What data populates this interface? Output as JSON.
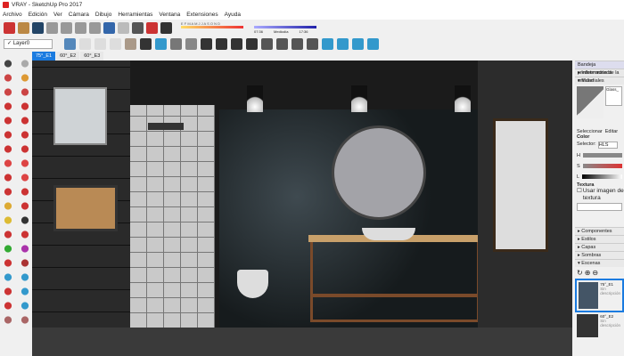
{
  "window": {
    "title": "VRAY - SketchUp Pro 2017"
  },
  "menu": [
    "Archivo",
    "Edición",
    "Ver",
    "Cámara",
    "Dibujo",
    "Herramientas",
    "Ventana",
    "Extensiones",
    "Ayuda"
  ],
  "toolbar": {
    "layer": "Layer0",
    "months": "E F M A M J J A S O N D",
    "time1": "07:36",
    "time_label": "Mediodía",
    "time2": "17:36"
  },
  "scene_tabs": [
    "75°_E1",
    "60°_E2",
    "60°_E3"
  ],
  "right_panel": {
    "title": "Bandeja predeterminada",
    "info": "Información de la entidad",
    "materials": "Materiales",
    "material_name": "Glass_",
    "tab_select": "Seleccionar",
    "tab_edit": "Editar",
    "color": "Color",
    "selector_label": "Selector:",
    "selector_value": "HLS",
    "h": "H",
    "s": "S",
    "l": "L",
    "texture": "Textura",
    "use_image": "Usar imagen de textura",
    "sections": [
      "Componentes",
      "Estilos",
      "Capas",
      "Sombras",
      "Escenas"
    ],
    "scenes": [
      {
        "name": "75°_E1",
        "desc": "Sin descripción"
      },
      {
        "name": "60°_E2",
        "desc": "Sin descripción"
      }
    ]
  },
  "colors": {
    "accent": "#1a7be0"
  }
}
